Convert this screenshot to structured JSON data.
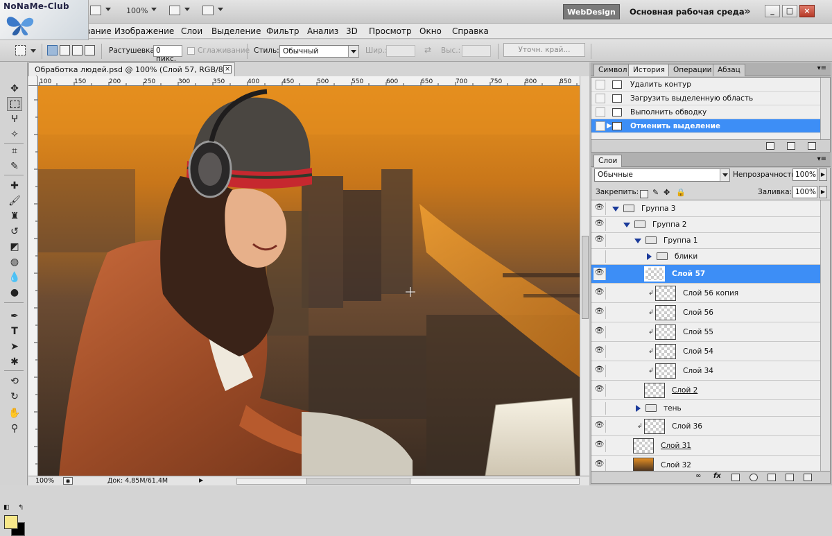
{
  "watermark": {
    "text": "NoNaMe-Club"
  },
  "appbar": {
    "zoom": "100%",
    "workspace_button": "WebDesign",
    "workspace_name": "Основная рабочая среда",
    "more": "»"
  },
  "menu": [
    "Редактирование",
    "Изображение",
    "Слои",
    "Выделение",
    "Фильтр",
    "Анализ",
    "3D",
    "Просмотр",
    "Окно",
    "Справка"
  ],
  "options": {
    "feather_label": "Растушевка:",
    "feather_value": "0 пикс.",
    "antialias_label": "Сглаживание",
    "style_label": "Стиль:",
    "style_value": "Обычный",
    "width_label": "Шир.:",
    "height_label": "Выс.:",
    "refine_label": "Уточн. край..."
  },
  "document": {
    "tab_title": "Обработка людей.psd @ 100% (Слой 57, RGB/8) *",
    "ruler_ticks": [
      "100",
      "150",
      "200",
      "250",
      "300",
      "350",
      "400",
      "450",
      "500",
      "550",
      "600",
      "650",
      "700",
      "750",
      "800",
      "850"
    ],
    "status_zoom": "100%",
    "status_doc": "Док: 4,85M/61,4M"
  },
  "history_panel": {
    "tabs": [
      "Символ",
      "История",
      "Операции",
      "Абзац"
    ],
    "active_tab": 1,
    "items": [
      {
        "label": "Удалить контур"
      },
      {
        "label": "Загрузить выделенную область"
      },
      {
        "label": "Выполнить обводку"
      },
      {
        "label": "Отменить выделение"
      }
    ],
    "selected": 3
  },
  "layers_panel": {
    "tab": "Слои",
    "blend_mode": "Обычные",
    "opacity_label": "Непрозрачность:",
    "opacity_value": "100%",
    "lock_label": "Закрепить:",
    "fill_label": "Заливка:",
    "fill_value": "100%",
    "layers": [
      {
        "name": "Группа 3",
        "type": "group",
        "open": true,
        "visible": true,
        "indent": 0
      },
      {
        "name": "Группа 2",
        "type": "group",
        "open": true,
        "visible": true,
        "indent": 1
      },
      {
        "name": "Группа 1",
        "type": "group",
        "open": true,
        "visible": true,
        "indent": 2
      },
      {
        "name": "блики",
        "type": "group",
        "open": false,
        "visible": false,
        "indent": 3
      },
      {
        "name": "Слой 57",
        "type": "layer",
        "visible": true,
        "indent": 3,
        "selected": true
      },
      {
        "name": "Слой 56 копия",
        "type": "layer",
        "visible": true,
        "indent": 4,
        "clipped": true
      },
      {
        "name": "Слой 56",
        "type": "layer",
        "visible": true,
        "indent": 4,
        "clipped": true
      },
      {
        "name": "Слой 55",
        "type": "layer",
        "visible": true,
        "indent": 4,
        "clipped": true
      },
      {
        "name": "Слой 54",
        "type": "layer",
        "visible": true,
        "indent": 4,
        "clipped": true
      },
      {
        "name": "Слой 34",
        "type": "layer",
        "visible": true,
        "indent": 4,
        "clipped": true
      },
      {
        "name": "Слой 2",
        "type": "layer",
        "visible": true,
        "indent": 3,
        "underline": true
      },
      {
        "name": "тень",
        "type": "group",
        "open": false,
        "visible": false,
        "indent": 2
      },
      {
        "name": "Слой 36",
        "type": "layer",
        "visible": true,
        "indent": 2,
        "clipped": true
      },
      {
        "name": "Слой 31",
        "type": "layer",
        "visible": true,
        "indent": 1,
        "underline": true
      },
      {
        "name": "Слой 32",
        "type": "layer",
        "visible": true,
        "indent": 1
      }
    ]
  },
  "colors": {
    "foreground": "#f8e88a",
    "background": "#000000",
    "selection": "#3d8ef6"
  }
}
